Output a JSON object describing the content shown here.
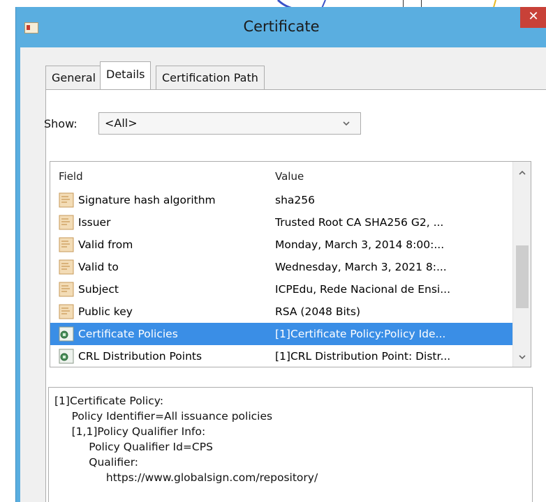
{
  "window": {
    "title": "Certificate",
    "close_glyph": "✕"
  },
  "tabs": [
    {
      "label": "General",
      "active": false
    },
    {
      "label": "Details",
      "active": true
    },
    {
      "label": "Certification Path",
      "active": false
    }
  ],
  "show": {
    "label": "Show:",
    "selected": "<All>"
  },
  "fields": {
    "column_field": "Field",
    "column_value": "Value",
    "rows": [
      {
        "field": "Signature hash algorithm",
        "value": "sha256",
        "icon": "certificate-field-icon"
      },
      {
        "field": "Issuer",
        "value": "Trusted Root CA SHA256 G2, ...",
        "icon": "certificate-field-icon"
      },
      {
        "field": "Valid from",
        "value": "Monday, March 3, 2014 8:00:...",
        "icon": "certificate-field-icon"
      },
      {
        "field": "Valid to",
        "value": "Wednesday, March 3, 2021 8:...",
        "icon": "certificate-field-icon"
      },
      {
        "field": "Subject",
        "value": "ICPEdu, Rede Nacional de Ensi...",
        "icon": "certificate-field-icon"
      },
      {
        "field": "Public key",
        "value": "RSA (2048 Bits)",
        "icon": "certificate-field-icon"
      },
      {
        "field": "Certificate Policies",
        "value": "[1]Certificate Policy:Policy Ide...",
        "icon": "certificate-extension-icon",
        "selected": true
      },
      {
        "field": "CRL Distribution Points",
        "value": "[1]CRL Distribution Point: Distr...",
        "icon": "certificate-extension-icon"
      }
    ]
  },
  "detail": {
    "text": "[1]Certificate Policy:\n     Policy Identifier=All issuance policies\n     [1,1]Policy Qualifier Info:\n          Policy Qualifier Id=CPS\n          Qualifier:\n               https://www.globalsign.com/repository/"
  },
  "colors": {
    "titlebar": "#5aaee0",
    "selection": "#3a8ee6",
    "close_button": "#c84138"
  }
}
